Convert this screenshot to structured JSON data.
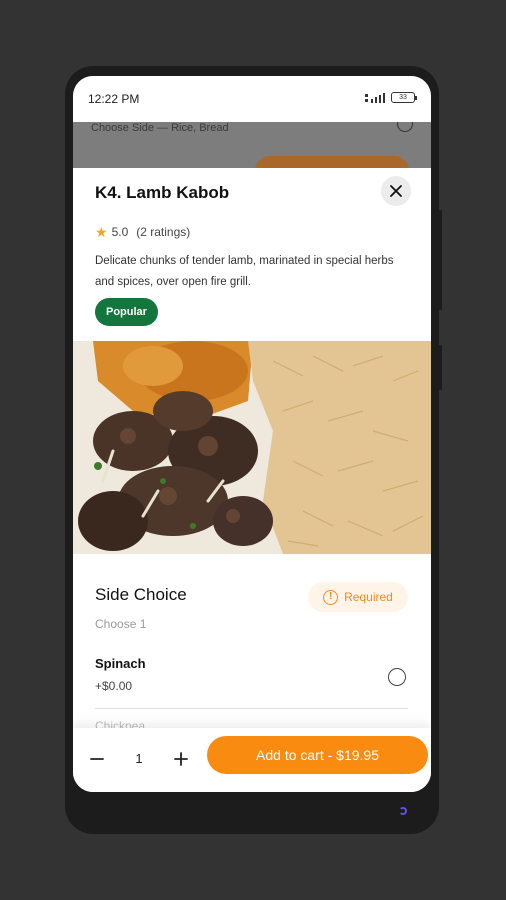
{
  "status_bar": {
    "time": "12:22 PM",
    "battery": "33"
  },
  "background_page": {
    "text": "Choose Side — Rice, Bread"
  },
  "item": {
    "title": "K4. Lamb Kabob",
    "rating": "5.0",
    "rating_count": "(2 ratings)",
    "description": "Delicate chunks of tender lamb, marinated in special herbs and spices, over open fire grill.",
    "badge": "Popular"
  },
  "side_choice": {
    "title": "Side Choice",
    "subtitle": "Choose 1",
    "required_label": "Required",
    "options": [
      {
        "name": "Spinach",
        "price": "+$0.00"
      }
    ],
    "next_option_peek": "Chickpea"
  },
  "cart": {
    "quantity": "1",
    "add_label": "Add to cart - $19.95"
  },
  "colors": {
    "accent": "#f88b10",
    "badge_green": "#13763c",
    "star": "#f5a623"
  },
  "icons": [
    "close-icon",
    "star-icon",
    "alert-icon",
    "radio-icon",
    "minus-icon",
    "plus-icon",
    "signal-icon",
    "battery-icon"
  ]
}
